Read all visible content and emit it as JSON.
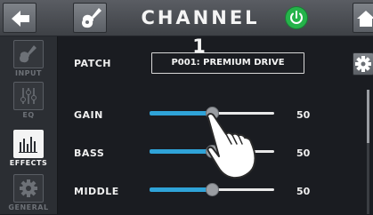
{
  "header": {
    "title": "CHANNEL 1",
    "back_icon": "arrow-left-icon",
    "guitar_icon": "guitar-icon",
    "power_icon": "power-icon",
    "home_icon": "home-icon",
    "power_color": "#25b34a"
  },
  "sidebar": {
    "items": [
      {
        "label": "INPUT",
        "icon": "guitar-jack-icon",
        "active": false
      },
      {
        "label": "EQ",
        "icon": "eq-icon",
        "active": false
      },
      {
        "label": "EFFECTS",
        "icon": "effects-bars-icon",
        "active": true
      },
      {
        "label": "GENERAL",
        "icon": "gear-icon",
        "active": false
      }
    ]
  },
  "main": {
    "patch_label": "PATCH",
    "patch_value": "P001: PREMIUM DRIVE",
    "params": [
      {
        "label": "GAIN",
        "value": "50",
        "level": 0.5
      },
      {
        "label": "BASS",
        "value": "50",
        "level": 0.5
      },
      {
        "label": "MIDDLE",
        "value": "50",
        "level": 0.5
      }
    ]
  },
  "right_rail": {
    "settings_icon": "gear-icon"
  },
  "accent_color": "#2fa3d8"
}
